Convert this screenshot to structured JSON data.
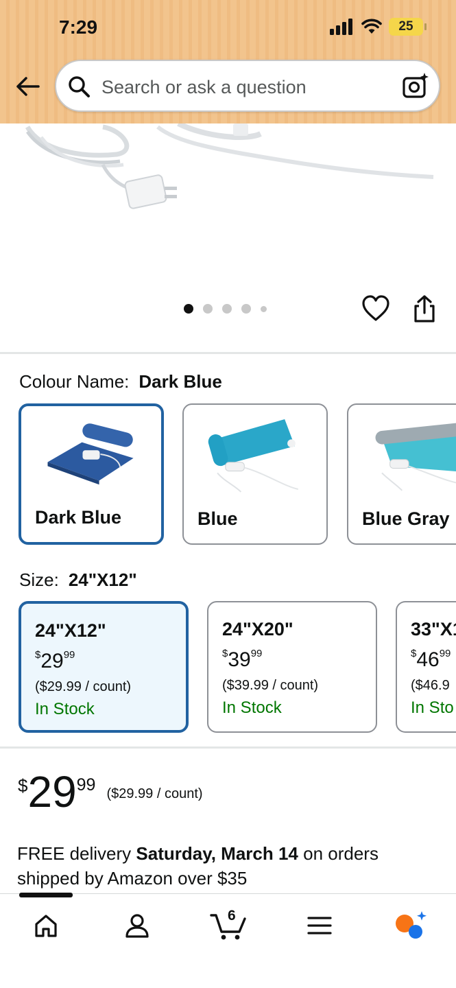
{
  "status_bar": {
    "time": "7:29",
    "battery": "25"
  },
  "search": {
    "placeholder": "Search or ask a question"
  },
  "image_carousel": {
    "total_dots": 5,
    "active_index": 0
  },
  "colour": {
    "label": "Colour Name:",
    "selected": "Dark Blue",
    "options": [
      {
        "label": "Dark Blue",
        "selected": true,
        "color": "#2c5aa0"
      },
      {
        "label": "Blue",
        "selected": false,
        "color": "#2aa7c9"
      },
      {
        "label": "Blue Gray",
        "selected": false,
        "color": "#45c0d2"
      }
    ]
  },
  "size": {
    "label": "Size:",
    "selected": "24\"X12\"",
    "options": [
      {
        "name": "24\"X12\"",
        "price_symbol": "$",
        "price_whole": "29",
        "price_fraction": "99",
        "unit_price": "($29.99 / count)",
        "stock": "In Stock",
        "selected": true
      },
      {
        "name": "24\"X20\"",
        "price_symbol": "$",
        "price_whole": "39",
        "price_fraction": "99",
        "unit_price": "($39.99 / count)",
        "stock": "In Stock",
        "selected": false
      },
      {
        "name": "33\"X1",
        "price_symbol": "$",
        "price_whole": "46",
        "price_fraction": "99",
        "unit_price": "($46.9",
        "stock": "In Sto",
        "selected": false
      }
    ]
  },
  "price": {
    "symbol": "$",
    "whole": "29",
    "fraction": "99",
    "unit": "($29.99 / count)"
  },
  "delivery": {
    "prefix": "FREE delivery ",
    "date": "Saturday, March 14",
    "suffix": " on orders shipped by Amazon over $35"
  },
  "nav": {
    "cart_count": "6"
  },
  "colors": {
    "accent_blue": "#2162a1",
    "in_stock_green": "#007600",
    "header_bg": "#f2c48d"
  }
}
